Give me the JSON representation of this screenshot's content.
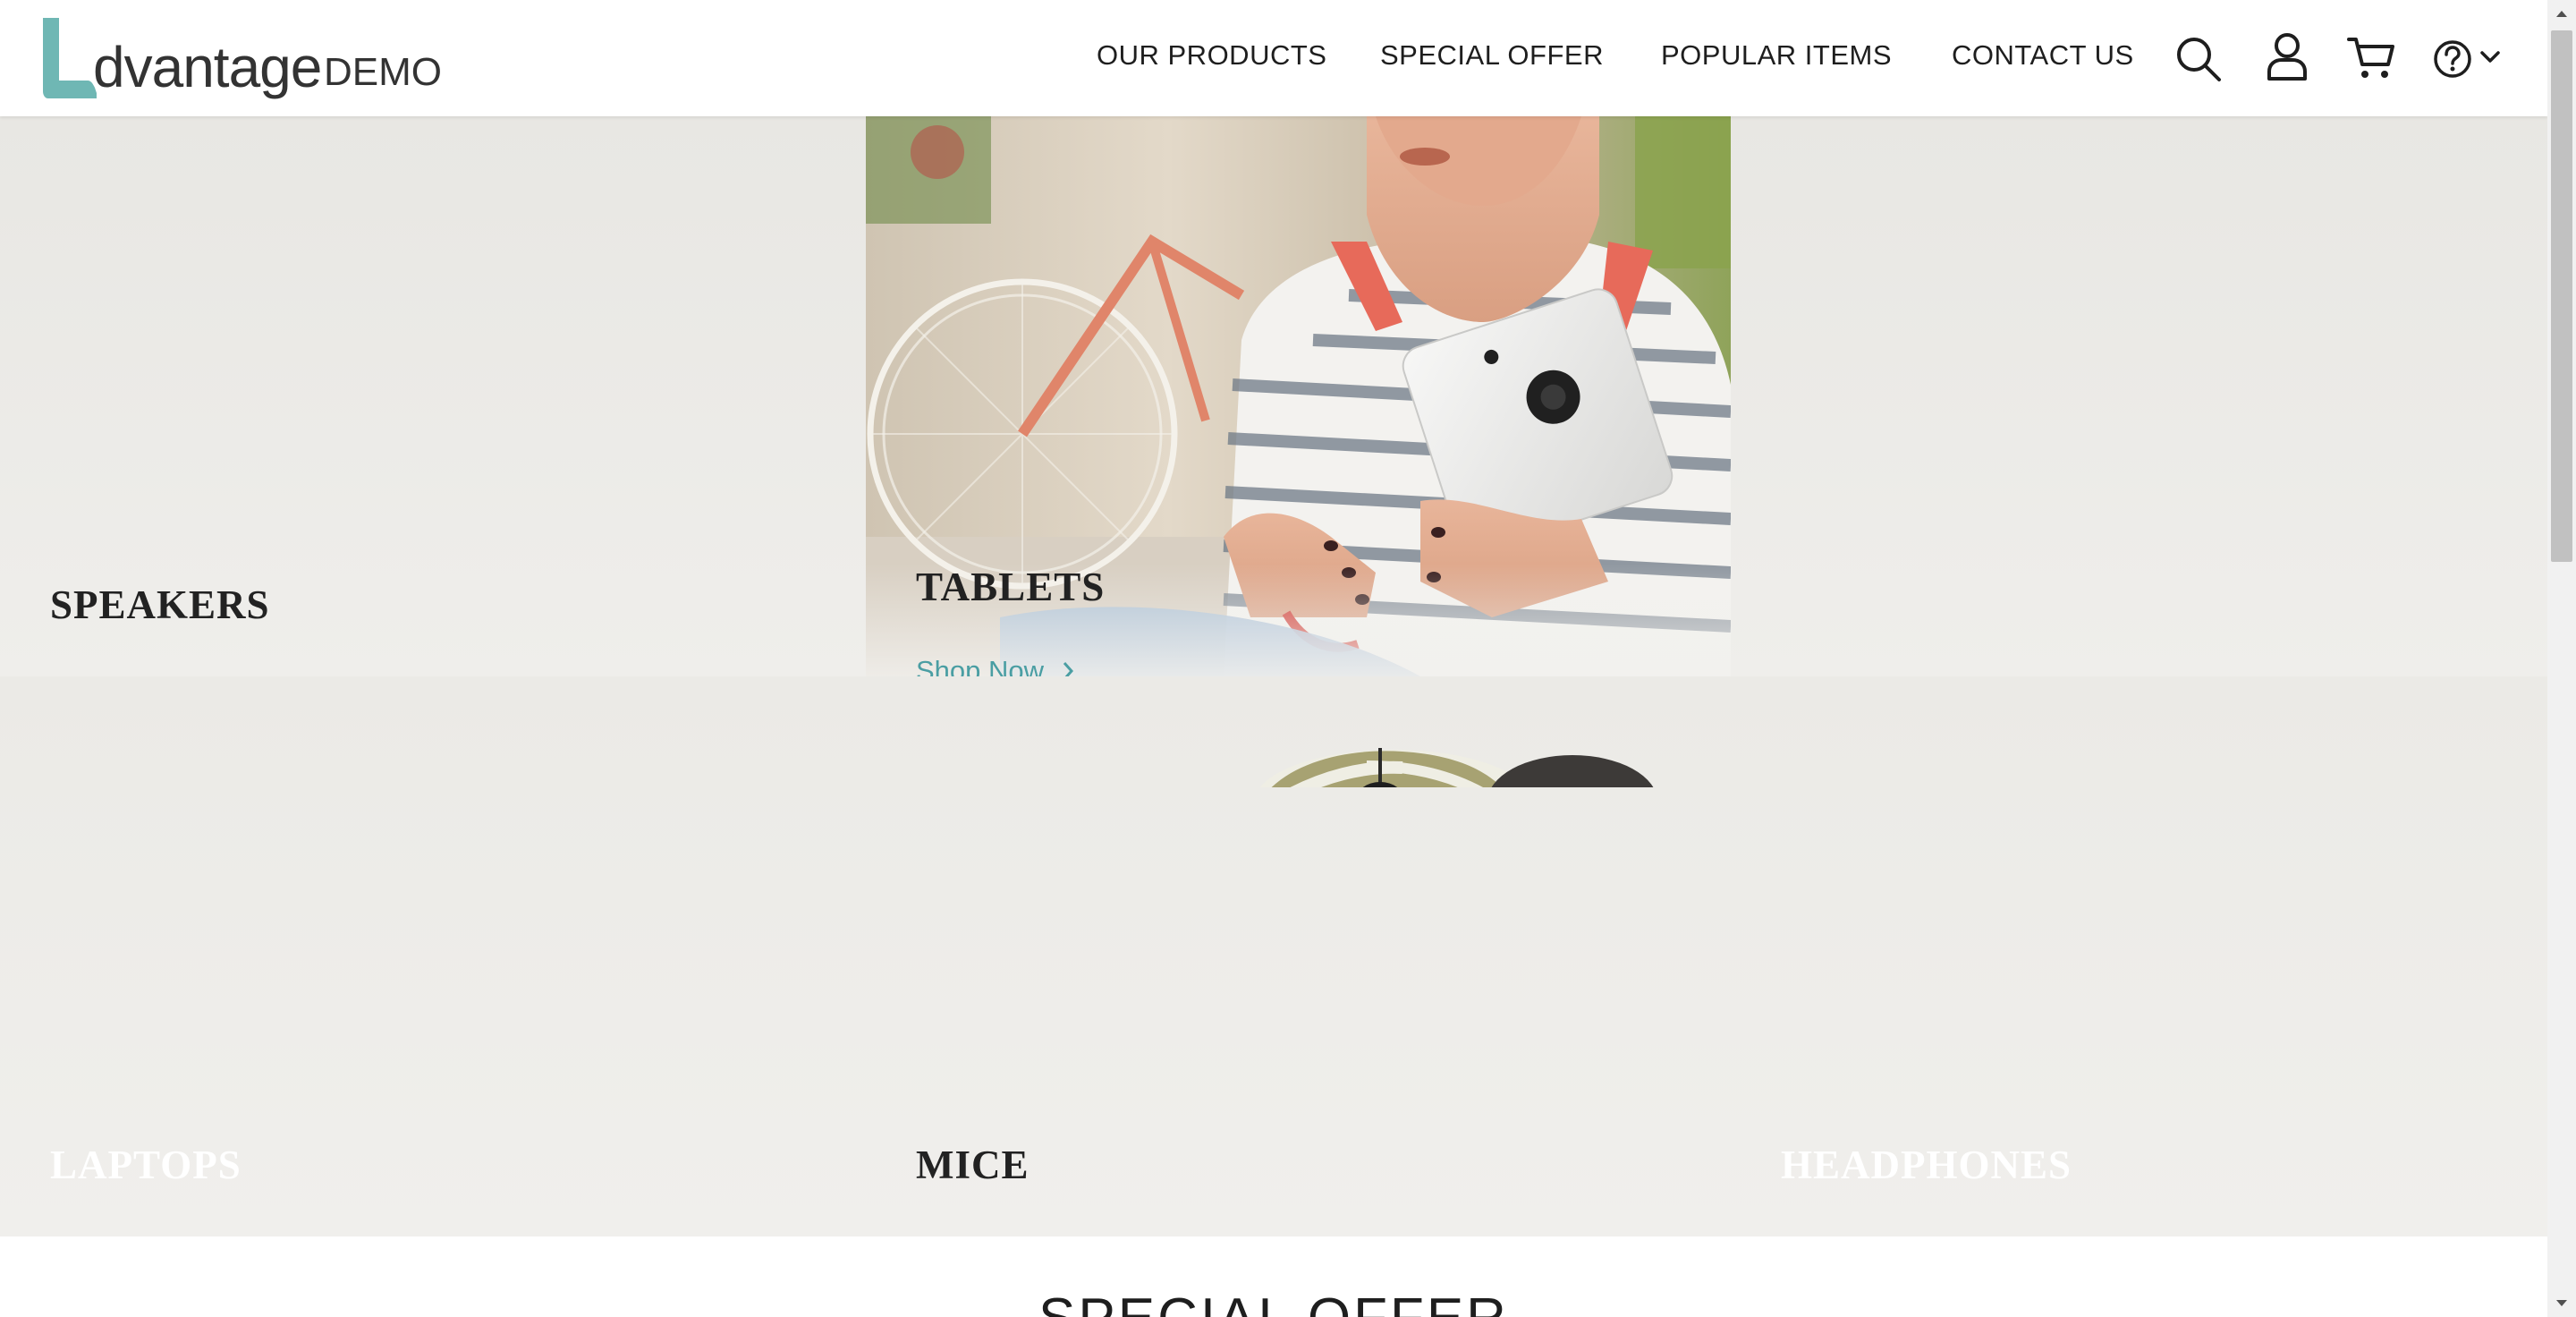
{
  "brand": {
    "word": "dvantage",
    "suffix": "DEMO",
    "accent_color": "#6fb7b4"
  },
  "nav": {
    "items": [
      {
        "label": "OUR PRODUCTS"
      },
      {
        "label": "SPECIAL OFFER"
      },
      {
        "label": "POPULAR ITEMS"
      },
      {
        "label": "CONTACT US"
      }
    ],
    "icons": [
      "search-icon",
      "user-icon",
      "cart-icon",
      "help-icon",
      "chevron-down-icon"
    ]
  },
  "categories": {
    "speakers": {
      "label": "SPEAKERS",
      "color": "#222222"
    },
    "tablets": {
      "label": "TABLETS",
      "shop_now": "Shop Now",
      "color": "#222222"
    },
    "laptops": {
      "label": "LAPTOPS",
      "color": "#ffffff"
    },
    "mice": {
      "label": "MICE",
      "color": "#222222"
    },
    "headphones": {
      "label": "HEADPHONES",
      "color": "#ffffff"
    }
  },
  "special_offer": {
    "title": "SPECIAL OFFER"
  }
}
